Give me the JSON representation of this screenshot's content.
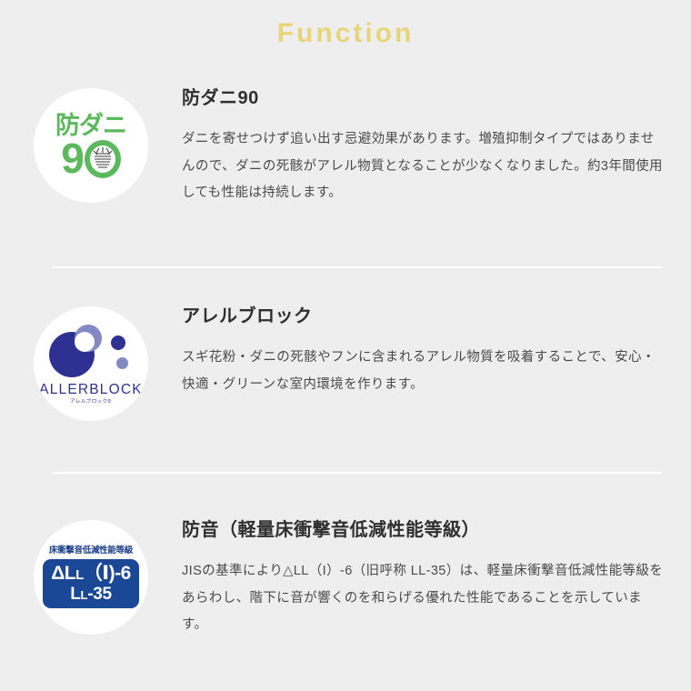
{
  "section": {
    "title": "Function"
  },
  "features": [
    {
      "id": "anti-mite",
      "heading": "防ダニ90",
      "body": "ダニを寄せつけず追い出す忌避効果があります。増殖抑制タイプではありませんので、ダニの死骸がアレル物質となることが少なくなりました。約3年間使用しても性能は持続します。",
      "badge": {
        "type": "circle-logo",
        "top_text": "防ダニ",
        "digit": "9",
        "icon": "mite-crossed-out-icon",
        "color": "#5cb85c"
      }
    },
    {
      "id": "allerblock",
      "heading": "アレルブロック",
      "body": "スギ花粉・ダニの死骸やフンに含まれるアレル物質を吸着することで、安心・快適・グリーンな室内環境を作ります。",
      "badge": {
        "type": "circle-logo",
        "wordmark": "ALLERBLOCK",
        "subtitle": "アレルブロック®",
        "icon": "overlapping-circles-icon",
        "color_primary": "#2e3192",
        "color_secondary": "#8289c4"
      }
    },
    {
      "id": "soundproof",
      "heading": "防音（軽量床衝撃音低減性能等級）",
      "body": "JISの基準により△LL（I）-6（旧呼称 LL-35）は、軽量床衝撃音低減性能等級をあらわし、階下に音が響くのを和らげる優れた性能であることを示しています。",
      "badge": {
        "type": "rounded-rect-label",
        "label": "床衝撃音低減性能等級",
        "grade_delta": "ΔL",
        "grade_sub": "L",
        "grade_rest": "（Ⅰ)-6",
        "old_name_prefix": "L",
        "old_name_sub": "L",
        "old_name_rest": "-35",
        "color": "#1b4896",
        "label_color": "#1b3f86"
      }
    }
  ],
  "colors": {
    "background": "#efeeee",
    "title": "#e8d57a",
    "heading": "#2f2f2f",
    "body": "#4a4a4a",
    "divider": "#ffffff"
  }
}
